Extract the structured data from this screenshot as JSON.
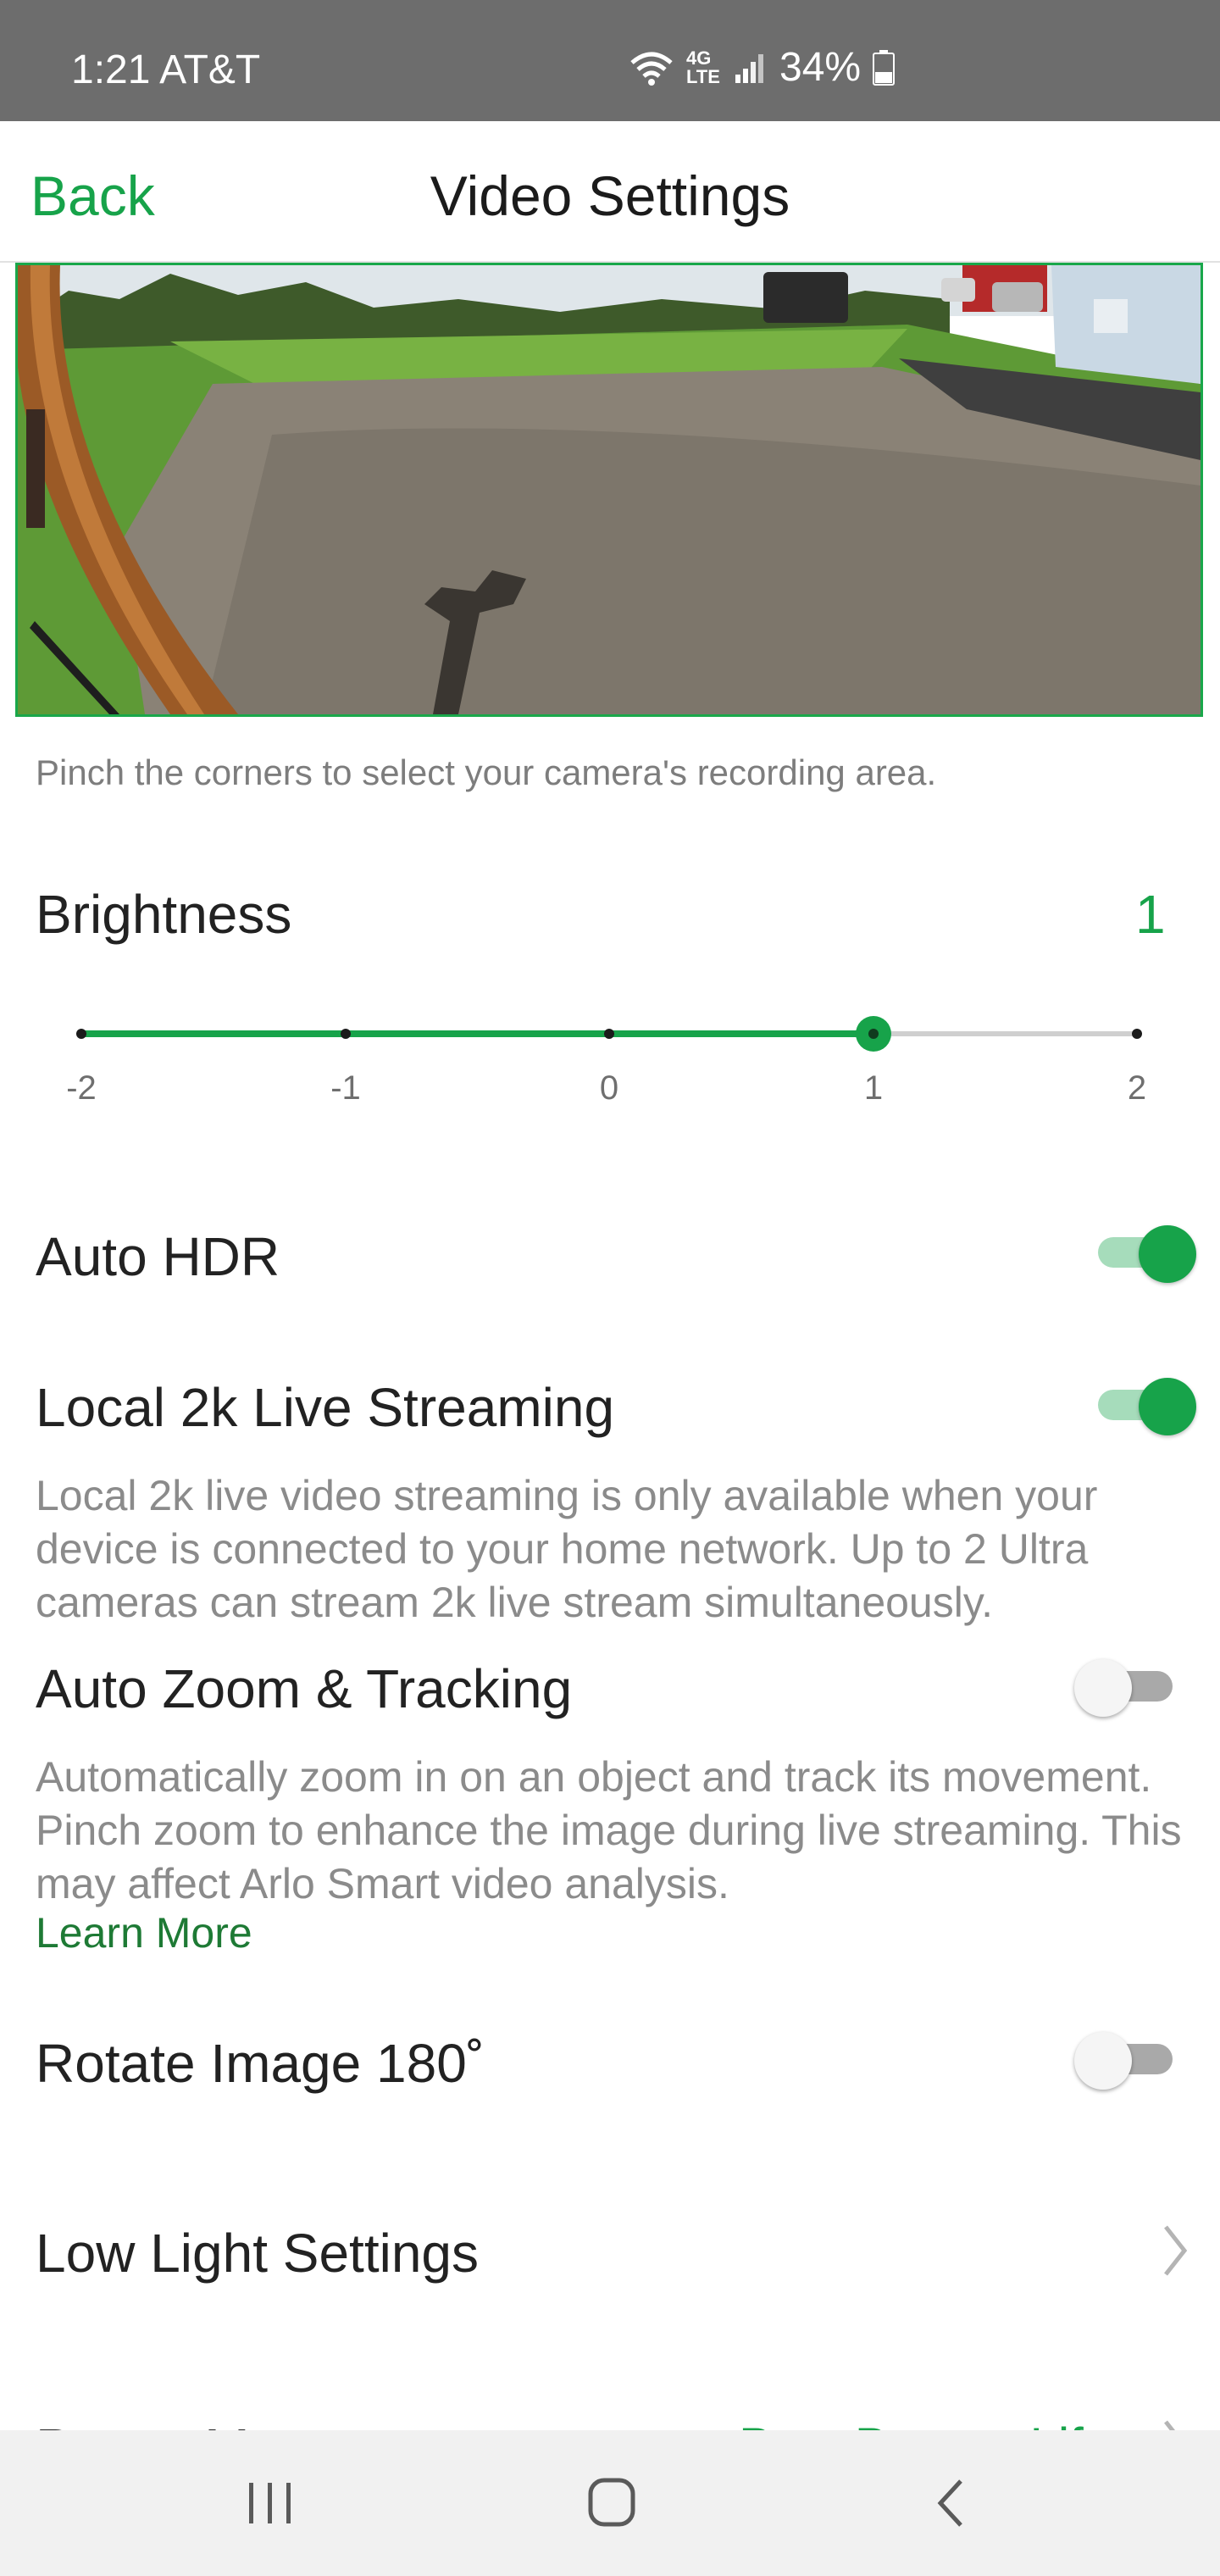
{
  "status_bar": {
    "time_carrier": "1:21 AT&T",
    "network_label": "4G LTE",
    "battery": "34%"
  },
  "navbar": {
    "back": "Back",
    "title": "Video Settings"
  },
  "preview": {
    "hint": "Pinch the corners to select your camera's recording area."
  },
  "brightness": {
    "label": "Brightness",
    "value": "1",
    "ticks": [
      "-2",
      "-1",
      "0",
      "1",
      "2"
    ],
    "selected_index": 3
  },
  "settings": {
    "auto_hdr": {
      "label": "Auto HDR",
      "on": true
    },
    "local_2k": {
      "label": "Local 2k Live Streaming",
      "on": true,
      "description": "Local 2k live video streaming is only available when your device is connected to your home network. Up to 2 Ultra cameras can stream 2k live stream simultaneously."
    },
    "auto_zoom": {
      "label": "Auto Zoom & Tracking",
      "on": false,
      "description": "Automatically zoom in on an object and track its movement. Pinch zoom to enhance the image during live streaming. This may affect Arlo Smart video analysis.",
      "link": "Learn More"
    },
    "rotate": {
      "label": "Rotate Image 180˚",
      "on": false
    },
    "low_light": {
      "label": "Low Light Settings"
    },
    "power": {
      "label": "Power Management",
      "value": "Best Battery Life"
    }
  },
  "colors": {
    "accent": "#17a34a",
    "status_bar": "#6d6d6d",
    "description_text": "#8b8b8b"
  },
  "icons": {
    "wifi": "wifi-icon",
    "signal": "signal-icon",
    "battery": "battery-icon",
    "chevron": "chevron-right-icon",
    "recents": "recents-icon",
    "home": "home-icon",
    "back": "back-icon"
  }
}
